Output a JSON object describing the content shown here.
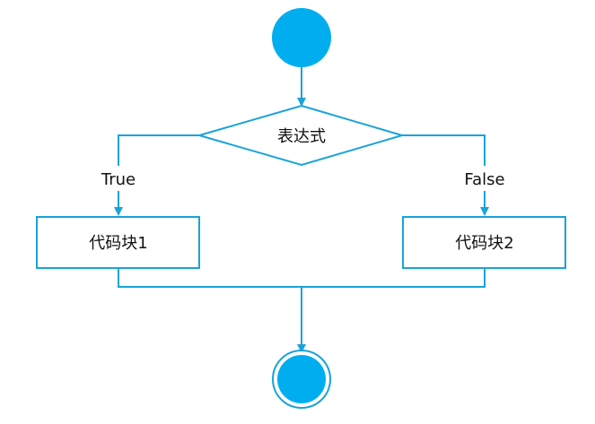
{
  "colors": {
    "accent": "#00AEEF",
    "line": "#1AA3D9",
    "text": "#111111",
    "background": "#FFFFFF"
  },
  "nodes": {
    "decision_label": "表达式",
    "block_true_label": "代码块1",
    "block_false_label": "代码块2"
  },
  "branches": {
    "true_label": "True",
    "false_label": "False"
  }
}
